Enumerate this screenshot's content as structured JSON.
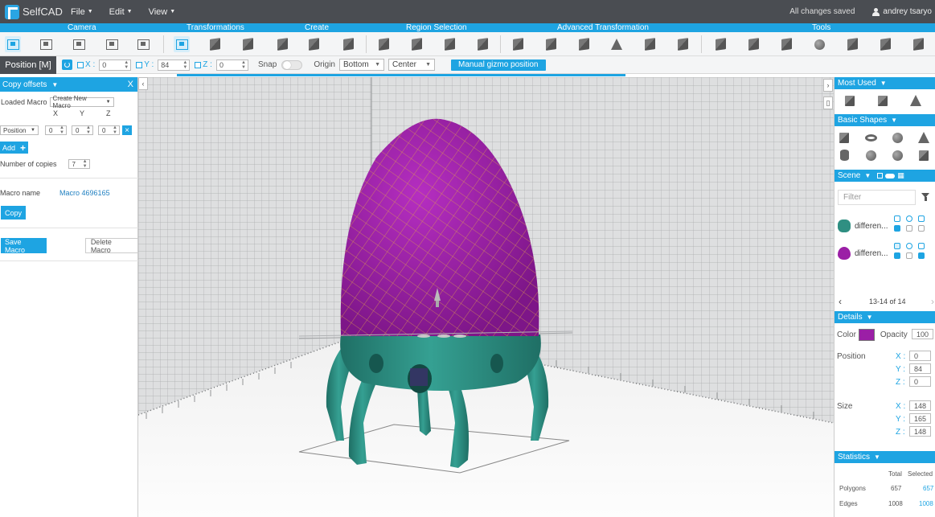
{
  "app": {
    "name": "SelfCAD",
    "menus": [
      "File",
      "Edit",
      "View"
    ],
    "save_status": "All changes saved",
    "user_name": "andrey tsaryo"
  },
  "categories": [
    "Camera",
    "Transformations",
    "Create",
    "Region Selection",
    "Advanced Transformation",
    "Tools"
  ],
  "position_bar": {
    "mode_label": "Position [M]",
    "x_label": "X :",
    "x_value": "0",
    "y_label": "Y :",
    "y_value": "84",
    "z_label": "Z :",
    "z_value": "0",
    "snap_label": "Snap",
    "origin_label": "Origin",
    "origin_value": "Bottom",
    "center_value": "Center",
    "gizmo_button": "Manual gizmo position",
    "gizmo_progress": 0.6
  },
  "left_panel": {
    "title": "Copy offsets",
    "close": "X",
    "loaded_macro_label": "Loaded Macro",
    "loaded_macro_value": "Create New Macro",
    "col_x": "X",
    "col_y": "Y",
    "col_z": "Z",
    "position_select": "Position",
    "pos_x": "0",
    "pos_y": "0",
    "pos_z": "0",
    "remove": "×",
    "add_label": "Add",
    "add_plus": "+",
    "copies_label": "Number of copies",
    "copies_value": "7",
    "macro_name_label": "Macro name",
    "macro_name_value": "Macro 4696165",
    "copy_button": "Copy",
    "save_macro_button": "Save Macro",
    "delete_macro_button": "Delete Macro"
  },
  "right_panel": {
    "most_used": "Most Used",
    "basic_shapes": "Basic Shapes",
    "scene": "Scene",
    "filter_placeholder": "Filter",
    "scene_items": [
      {
        "name": "differen...",
        "color": "#2f8f82"
      },
      {
        "name": "differen...",
        "color": "#9b1fa6"
      }
    ],
    "pager": "13-14 of 14",
    "details": "Details",
    "color_label": "Color",
    "color_value": "#9b1fa6",
    "opacity_label": "Opacity",
    "opacity_value": "100",
    "position_label": "Position",
    "pos_x_label": "X :",
    "pos_x": "0",
    "pos_y_label": "Y :",
    "pos_y": "84",
    "pos_z_label": "Z :",
    "pos_z": "0",
    "size_label": "Size",
    "size_x_label": "X :",
    "size_x": "148",
    "size_y_label": "Y :",
    "size_y": "165",
    "size_z_label": "Z :",
    "size_z": "148",
    "statistics": "Statistics",
    "stats_total": "Total",
    "stats_selected": "Selected",
    "polygons_label": "Polygons",
    "polygons_total": "657",
    "polygons_selected": "657",
    "edges_label": "Edges",
    "edges_total": "1008",
    "edges_selected": "1008"
  },
  "colors": {
    "accent": "#1ea4e2",
    "menubar": "#4a4d52",
    "egg": "#9b1fa6",
    "base": "#2f8f82"
  }
}
